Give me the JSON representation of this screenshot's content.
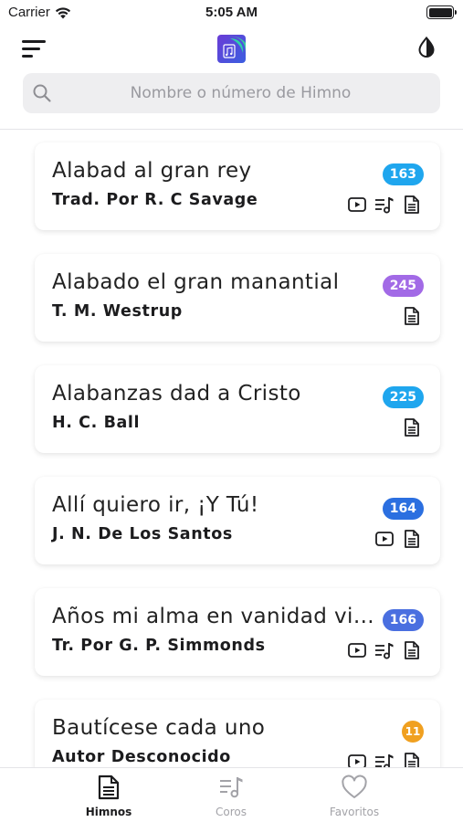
{
  "status": {
    "carrier": "Carrier",
    "time": "5:05 AM"
  },
  "search": {
    "placeholder": "Nombre o número de Himno",
    "value": ""
  },
  "colors": {
    "blue": "#1fa6ee",
    "purple": "#a26ae6",
    "darkblue": "#2b6fe0",
    "indigo": "#4a6fe0",
    "orange": "#f0a020"
  },
  "hymns": [
    {
      "title": "Alabad al gran rey",
      "author": "Trad. Por R. C Savage",
      "number": "163",
      "badge_color": "#1fa6ee",
      "icons": [
        "video-icon",
        "music-list-icon",
        "lyrics-icon"
      ]
    },
    {
      "title": "Alabado el gran manantial",
      "author": "T. M. Westrup",
      "number": "245",
      "badge_color": "#a26ae6",
      "icons": [
        "lyrics-icon"
      ]
    },
    {
      "title": "Alabanzas dad a Cristo",
      "author": "H. C. Ball",
      "number": "225",
      "badge_color": "#1fa6ee",
      "icons": [
        "lyrics-icon"
      ]
    },
    {
      "title": "Allí quiero ir, ¡Y Tú!",
      "author": "J. N. De Los Santos",
      "number": "164",
      "badge_color": "#2b6fe0",
      "icons": [
        "video-icon",
        "lyrics-icon"
      ]
    },
    {
      "title": "Años mi alma en vanidad vivió",
      "author": "Tr. Por G. P. Simmonds",
      "number": "166",
      "badge_color": "#4a6fe0",
      "icons": [
        "video-icon",
        "music-list-icon",
        "lyrics-icon"
      ]
    },
    {
      "title": "Bautícese cada uno",
      "author": "Autor Desconocido",
      "number": "11",
      "badge_color": "#f0a020",
      "icons": [
        "video-icon",
        "music-list-icon",
        "lyrics-icon"
      ]
    }
  ],
  "tabs": [
    {
      "label": "Himnos",
      "icon": "lyrics-icon",
      "active": true
    },
    {
      "label": "Coros",
      "icon": "music-list-icon",
      "active": false
    },
    {
      "label": "Favoritos",
      "icon": "heart-icon",
      "active": false
    }
  ]
}
